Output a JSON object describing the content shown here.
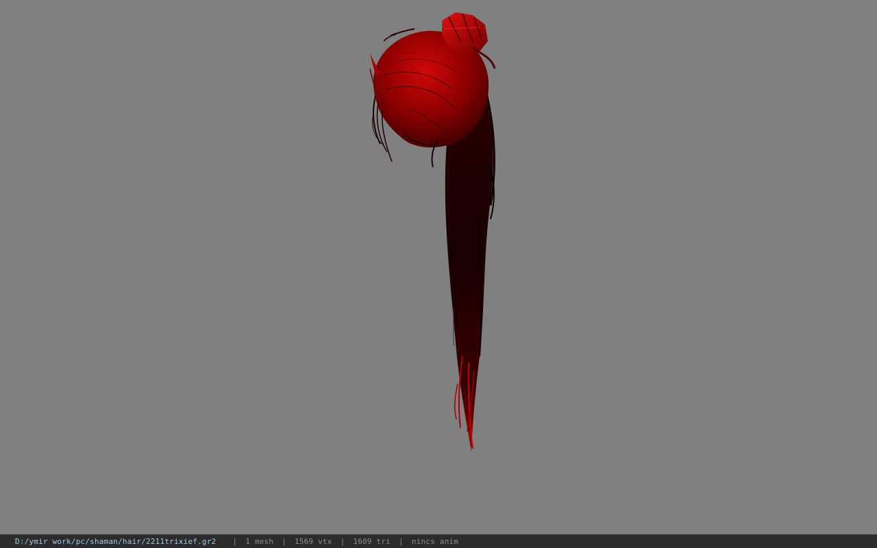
{
  "viewport": {
    "background": "#808080",
    "model_name": "hair model (red ponytail)"
  },
  "statusbar": {
    "file_path": "D:/ymir work/pc/shaman/hair/2211trixief.gr2",
    "separator": "|",
    "mesh": "1 mesh",
    "vertices": "1569 vtx",
    "triangles": "1609 tri",
    "animation": "nincs anim"
  },
  "colors": {
    "hair_red": "#c00000",
    "hair_dark": "#200000",
    "status_bg": "#2b2b2b",
    "path_text": "#9ecbe8"
  }
}
